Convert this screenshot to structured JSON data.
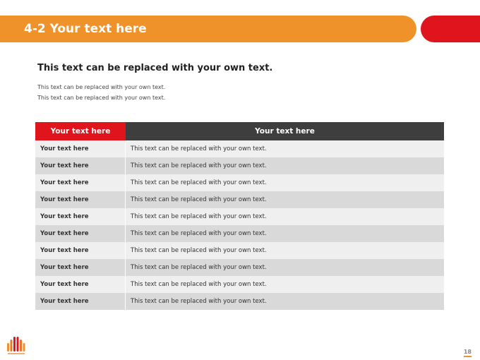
{
  "header": {
    "title": "4-2 Your text here"
  },
  "content": {
    "subtitle": "This text can be replaced with your own text.",
    "desc_lines": [
      "This text can be replaced with your own text.",
      "This text can be replaced with your own text."
    ]
  },
  "table": {
    "headers": [
      "Your text here",
      "Your text here"
    ],
    "rows": [
      [
        "Your text here",
        "This text can be replaced with your own text."
      ],
      [
        "Your text here",
        "This text can be replaced with your own text."
      ],
      [
        "Your text here",
        "This text can be replaced with your own text."
      ],
      [
        "Your text here",
        "This text can be replaced with your own text."
      ],
      [
        "Your text here",
        "This text can be replaced with your own text."
      ],
      [
        "Your text here",
        "This text can be replaced with your own text."
      ],
      [
        "Your text here",
        "This text can be replaced with your own text."
      ],
      [
        "Your text here",
        "This text can be replaced with your own text."
      ],
      [
        "Your text here",
        "This text can be replaced with your own text."
      ],
      [
        "Your text here",
        "This text can be replaced with your own text."
      ]
    ]
  },
  "footer": {
    "page_number": "18",
    "logo_icon": "logo-icon"
  },
  "colors": {
    "accent_orange": "#f0922a",
    "accent_red": "#e0141c",
    "header_dark": "#3f3e3e"
  }
}
